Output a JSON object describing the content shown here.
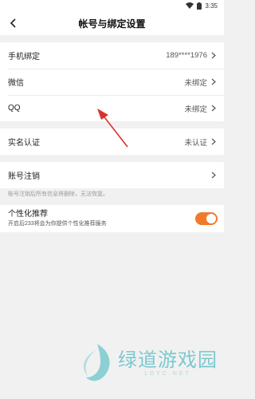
{
  "status_bar": {
    "time": "3:35"
  },
  "header": {
    "title": "帐号与绑定设置"
  },
  "bindings": [
    {
      "label": "手机绑定",
      "value": "189****1976"
    },
    {
      "label": "微信",
      "value": "未绑定"
    },
    {
      "label": "QQ",
      "value": "未绑定"
    }
  ],
  "verification": {
    "label": "实名认证",
    "value": "未认证"
  },
  "cancel": {
    "label": "账号注销",
    "note": "账号注销后所有信息将删除，无法恢复。"
  },
  "personalization": {
    "title": "个性化推荐",
    "description": "开启后233将会为你提供个性化推荐服务",
    "enabled": true
  },
  "watermark": {
    "text_cn": "绿道游戏园",
    "text_en": "LDYC.NET"
  },
  "colors": {
    "accent": "#f07b2a",
    "arrow": "#d9322e",
    "watermark": "#5bbfc6"
  }
}
